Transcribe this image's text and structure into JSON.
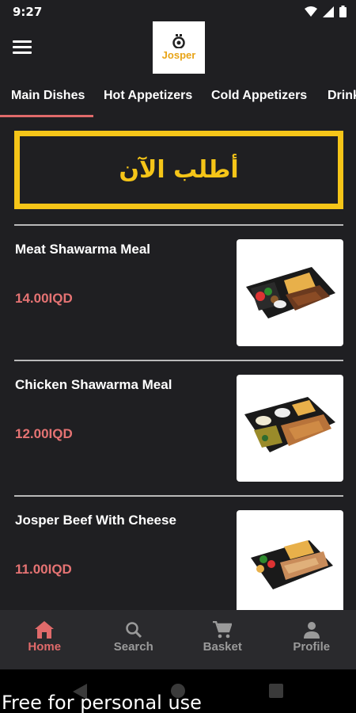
{
  "status_bar": {
    "time": "9:27",
    "icons": [
      "wifi-icon",
      "signal-icon",
      "battery-icon"
    ]
  },
  "header": {
    "logo_text": "Josper",
    "menu_icon": "hamburger-icon"
  },
  "tabs": [
    "Main Dishes",
    "Hot Appetizers",
    "Cold Appetizers",
    "Drink"
  ],
  "active_tab": "Main Dishes",
  "order_banner": {
    "label": "أطلب الآن"
  },
  "menu_items": [
    {
      "name": "Meat Shawarma Meal",
      "price": "14.00IQD"
    },
    {
      "name": "Chicken Shawarma Meal",
      "price": "12.00IQD"
    },
    {
      "name": "Josper Beef With Cheese",
      "price": "11.00IQD"
    }
  ],
  "bottom_nav": [
    {
      "label": "Home",
      "icon": "home-icon",
      "active": true
    },
    {
      "label": "Search",
      "icon": "search-icon",
      "active": false
    },
    {
      "label": "Basket",
      "icon": "cart-icon",
      "active": false
    },
    {
      "label": "Profile",
      "icon": "person-icon",
      "active": false
    }
  ],
  "watermark": "Free for personal use",
  "colors": {
    "accent": "#e06a6a",
    "banner": "#f5c518",
    "background": "#1f1f22",
    "nav_bg": "#2a2a2d"
  }
}
